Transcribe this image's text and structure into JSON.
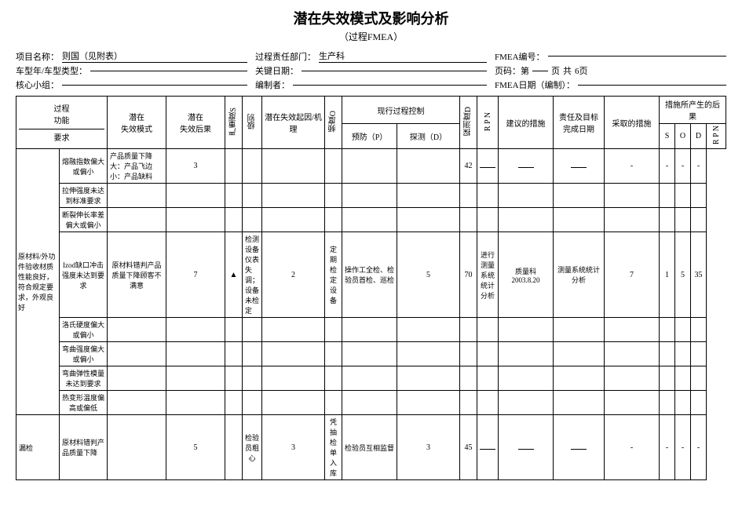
{
  "title": "潜在失效模式及影响分析",
  "subtitle": "（过程FMEA）",
  "meta": {
    "project_label": "项目名称：",
    "project_value": "则国（见附表）",
    "dept_label": "过程责任部门：",
    "dept_value": "生产科",
    "fmea_no_label": "FMEA编号：",
    "fmea_no_value": "",
    "page_label": "页码：第",
    "page_num": "页",
    "page_total_label": "共",
    "page_total": "6页",
    "year_label": "车型年/车型类型：",
    "year_value": "",
    "date_label": "关键日期：",
    "date_value": "",
    "editor_label": "编制者：",
    "editor_value": "",
    "team_label": "核心小组：",
    "team_value": "",
    "fmea_date_label": "FMEA日期（编制）：",
    "fmea_date_value": ""
  },
  "table": {
    "headers": {
      "process_function": "过程功能",
      "requirements": "要求",
      "potential_failure_mode": "潜在失效模式",
      "potential_effects": "潜在失效后果",
      "severity": "严重度S",
      "class": "级别",
      "potential_causes": "潜在失效起因/机理",
      "occurrence": "频度O",
      "current_controls": "现行过程控制",
      "prevention": "预防（P）",
      "detection": "探测（D）",
      "detection_d": "探测度D",
      "rpn": "R P N",
      "recommendations": "建议的措施",
      "responsible": "责任及目标完成日期",
      "actions_taken": "采取的措施",
      "results": "措施所产生的后果",
      "s": "S",
      "o": "O",
      "d": "D",
      "rpn2": "R P N"
    },
    "rows": [
      {
        "process": "原材料/外功件验收材质性能良好，符合规定要求，外观良好",
        "failure_mode": "熔融指数偏大或偏小",
        "effects": "产品质量下降大：产品飞边小：产品缺料",
        "severity": "3",
        "class": "",
        "causes": "",
        "occurrence": "",
        "prevention": "",
        "detection": "",
        "det_d": "",
        "rpn": "42",
        "recommendations": "",
        "responsible": "",
        "actions_taken": "",
        "s2": "-",
        "o2": "-",
        "d2": "-",
        "rpn2": "-",
        "rowspan_process": 9
      },
      {
        "failure_mode": "拉伸强度未达到标准要求",
        "effects": "",
        "severity": "",
        "class": "",
        "causes": "",
        "occurrence": "",
        "prevention": "",
        "detection": "",
        "det_d": "",
        "rpn": "",
        "recommendations": "",
        "responsible": "",
        "actions_taken": "",
        "s2": "",
        "o2": "",
        "d2": "",
        "rpn2": ""
      },
      {
        "failure_mode": "断裂伸长率差偏大或偏小",
        "effects": "",
        "severity": "",
        "class": "",
        "causes": "",
        "occurrence": "",
        "prevention": "",
        "detection": "",
        "det_d": "",
        "rpn": "",
        "recommendations": "",
        "responsible": "",
        "actions_taken": "",
        "s2": "",
        "o2": "",
        "d2": "",
        "rpn2": ""
      },
      {
        "failure_mode": "Izod缺口冲击强度未达到要求",
        "effects": "原材料错判产品质量下降顾客不满意",
        "severity": "7",
        "class": "▲",
        "causes": "检测设备仪表失调；设备未检定",
        "occurrence": "2",
        "prevention": "定期检定设备",
        "detection": "操作工全检、检验员首检、巡检",
        "det_d": "5",
        "rpn": "70",
        "recommendations": "进行测量系统分析",
        "responsible": "质量科 2003.8.20",
        "actions_taken": "测量系统统计分析",
        "s2": "7",
        "o2": "1",
        "d2": "5",
        "rpn2": "35"
      },
      {
        "failure_mode": "洛氏硬度偏大或偏小",
        "effects": "",
        "severity": "",
        "class": "",
        "causes": "",
        "occurrence": "",
        "prevention": "",
        "detection": "",
        "det_d": "",
        "rpn": "",
        "recommendations": "",
        "responsible": "",
        "actions_taken": "",
        "s2": "",
        "o2": "",
        "d2": "",
        "rpn2": ""
      },
      {
        "failure_mode": "弯曲强度偏大或偏小",
        "effects": "",
        "severity": "",
        "class": "",
        "causes": "",
        "occurrence": "",
        "prevention": "",
        "detection": "",
        "det_d": "",
        "rpn": "",
        "recommendations": "",
        "responsible": "",
        "actions_taken": "",
        "s2": "",
        "o2": "",
        "d2": "",
        "rpn2": ""
      },
      {
        "failure_mode": "弯曲弹性模量未达到要求",
        "effects": "",
        "severity": "",
        "class": "",
        "causes": "",
        "occurrence": "",
        "prevention": "",
        "detection": "",
        "det_d": "",
        "rpn": "",
        "recommendations": "",
        "responsible": "",
        "actions_taken": "",
        "s2": "",
        "o2": "",
        "d2": "",
        "rpn2": ""
      },
      {
        "failure_mode": "热变形温度偏高或偏低",
        "effects": "",
        "severity": "",
        "class": "",
        "causes": "",
        "occurrence": "",
        "prevention": "",
        "detection": "",
        "det_d": "",
        "rpn": "",
        "recommendations": "",
        "responsible": "",
        "actions_taken": "",
        "s2": "",
        "o2": "",
        "d2": "",
        "rpn2": ""
      },
      {
        "process2": "漏检",
        "failure_mode2": "原材料错判产品质量下降",
        "severity2": "5",
        "causes2": "检验员粗心",
        "occurrence2": "3",
        "prevention2": "凭抽检单入库",
        "detection2": "检验员互相监督",
        "det_d2": "3",
        "rpn_val2": "45",
        "s2": "-",
        "o2": "-",
        "d2": "-",
        "rpn2": "-"
      }
    ]
  }
}
